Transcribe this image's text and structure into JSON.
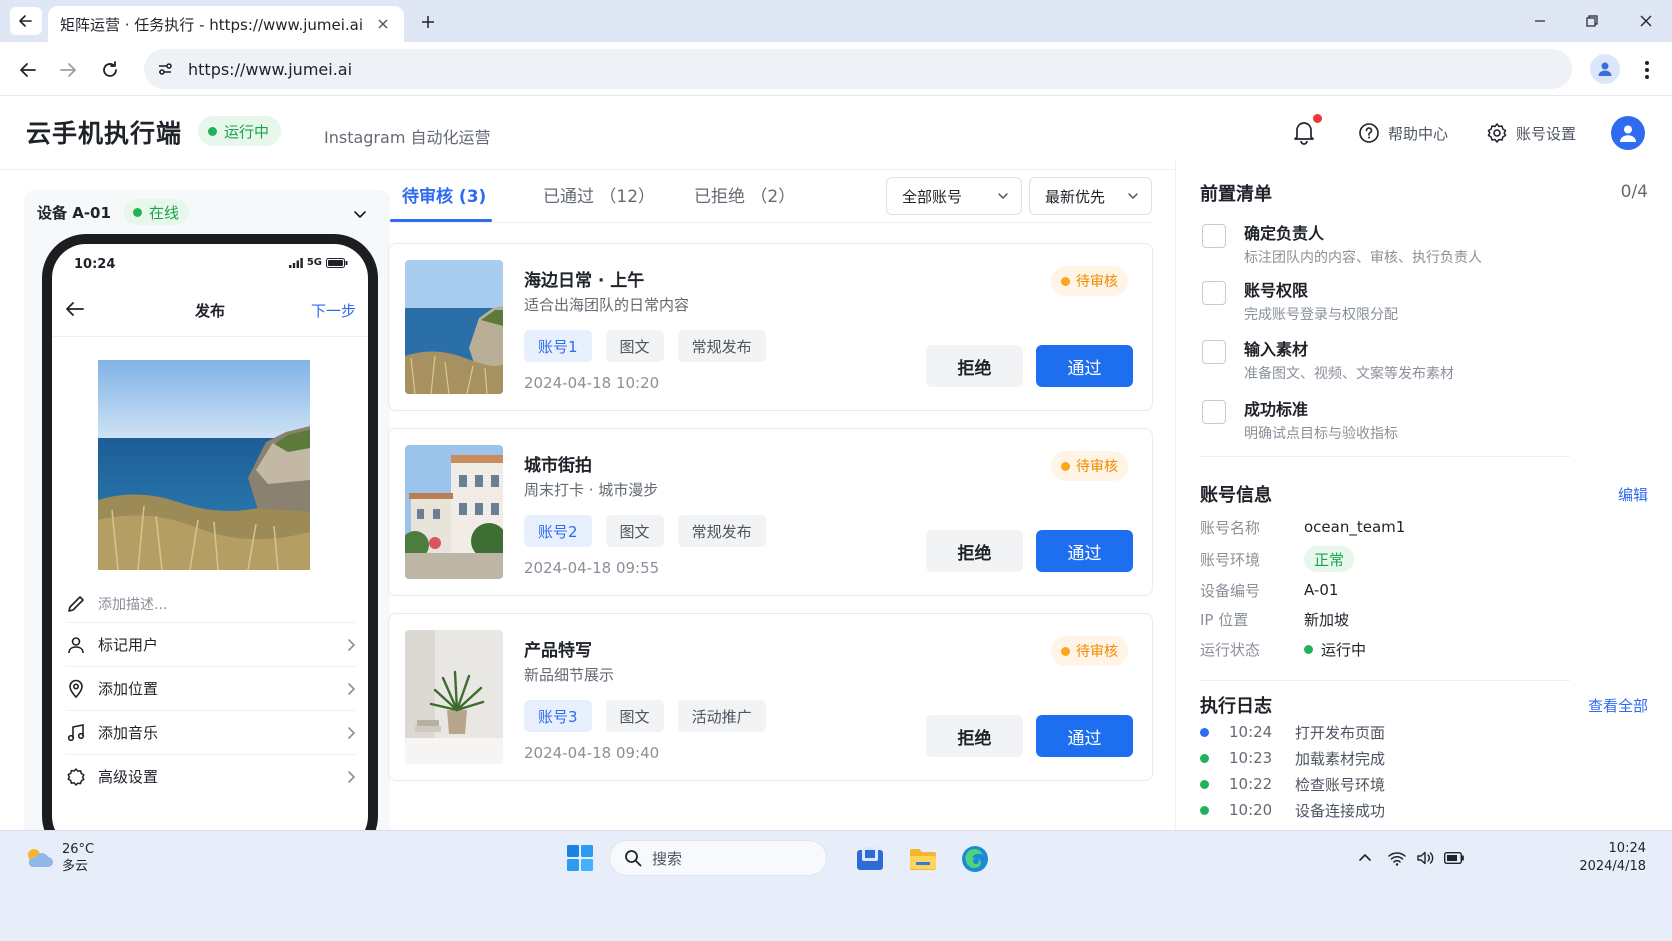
{
  "browser": {
    "tab_title": "矩阵运营 · 任务执行 - https://www.jumei.ai",
    "url": "https://www.jumei.ai"
  },
  "header": {
    "title": "云手机执行端",
    "status": "运行中",
    "subtitle": "Instagram 自动化运营",
    "help": "帮助中心",
    "settings": "账号设置"
  },
  "device": {
    "name": "设备 A-01",
    "status": "在线",
    "phone": {
      "time": "10:24",
      "network": "5G",
      "title": "发布",
      "next": "下一步",
      "description_placeholder": "添加描述...",
      "rows": [
        {
          "label": "标记用户",
          "icon": "user-icon"
        },
        {
          "label": "添加位置",
          "icon": "location-icon"
        },
        {
          "label": "添加音乐",
          "icon": "music-icon"
        },
        {
          "label": "高级设置",
          "icon": "gear-icon"
        }
      ]
    }
  },
  "review": {
    "tabs": [
      {
        "label": "待审核 (3)",
        "active": true
      },
      {
        "label": "已通过 （12）",
        "active": false
      },
      {
        "label": "已拒绝 （2）",
        "active": false
      }
    ],
    "filter_account": "全部账号",
    "filter_sort": "最新优先",
    "reject_label": "拒绝",
    "pass_label": "通过",
    "items": [
      {
        "title": "海边日常 · 上午",
        "subtitle": "适合出海团队的日常内容",
        "tags": [
          "账号1",
          "图文",
          "常规发布"
        ],
        "time": "2024-04-18 10:20",
        "status": "待审核",
        "thumb": "sea-cliff"
      },
      {
        "title": "城市街拍",
        "subtitle": "周末打卡 · 城市漫步",
        "tags": [
          "账号2",
          "图文",
          "常规发布"
        ],
        "time": "2024-04-18 09:55",
        "status": "待审核",
        "thumb": "street"
      },
      {
        "title": "产品特写",
        "subtitle": "新品细节展示",
        "tags": [
          "账号3",
          "图文",
          "活动推广"
        ],
        "time": "2024-04-18 09:40",
        "status": "待审核",
        "thumb": "plant"
      }
    ]
  },
  "checklist": {
    "title": "前置清单",
    "progress": "0/4",
    "items": [
      {
        "title": "确定负责人",
        "desc": "标注团队内的内容、审核、执行负责人"
      },
      {
        "title": "账号权限",
        "desc": "完成账号登录与权限分配"
      },
      {
        "title": "输入素材",
        "desc": "准备图文、视频、文案等发布素材"
      },
      {
        "title": "成功标准",
        "desc": "明确试点目标与验收指标"
      }
    ]
  },
  "account_info": {
    "title": "账号信息",
    "edit": "编辑",
    "rows": [
      {
        "key": "账号名称",
        "value": "ocean_team1"
      },
      {
        "key": "账号环境",
        "value": "正常"
      },
      {
        "key": "设备编号",
        "value": "A-01"
      },
      {
        "key": "IP 位置",
        "value": "新加坡"
      },
      {
        "key": "运行状态",
        "value": "运行中"
      }
    ]
  },
  "logs": {
    "title": "执行日志",
    "view_all": "查看全部",
    "items": [
      {
        "time": "10:24",
        "text": "打开发布页面",
        "color": "#2f6bf0"
      },
      {
        "time": "10:23",
        "text": "加载素材完成",
        "color": "#22b35a"
      },
      {
        "time": "10:22",
        "text": "检查账号环境",
        "color": "#22b35a"
      },
      {
        "time": "10:20",
        "text": "设备连接成功",
        "color": "#22b35a"
      }
    ]
  },
  "taskbar": {
    "temperature": "26°C",
    "weather": "多云",
    "search": "搜索",
    "time": "10:24",
    "date": "2024/4/18"
  },
  "colors": {
    "primary": "#1e6ff0",
    "success": "#22b35a",
    "warning": "#f08c00",
    "notification": "#f0363a"
  }
}
